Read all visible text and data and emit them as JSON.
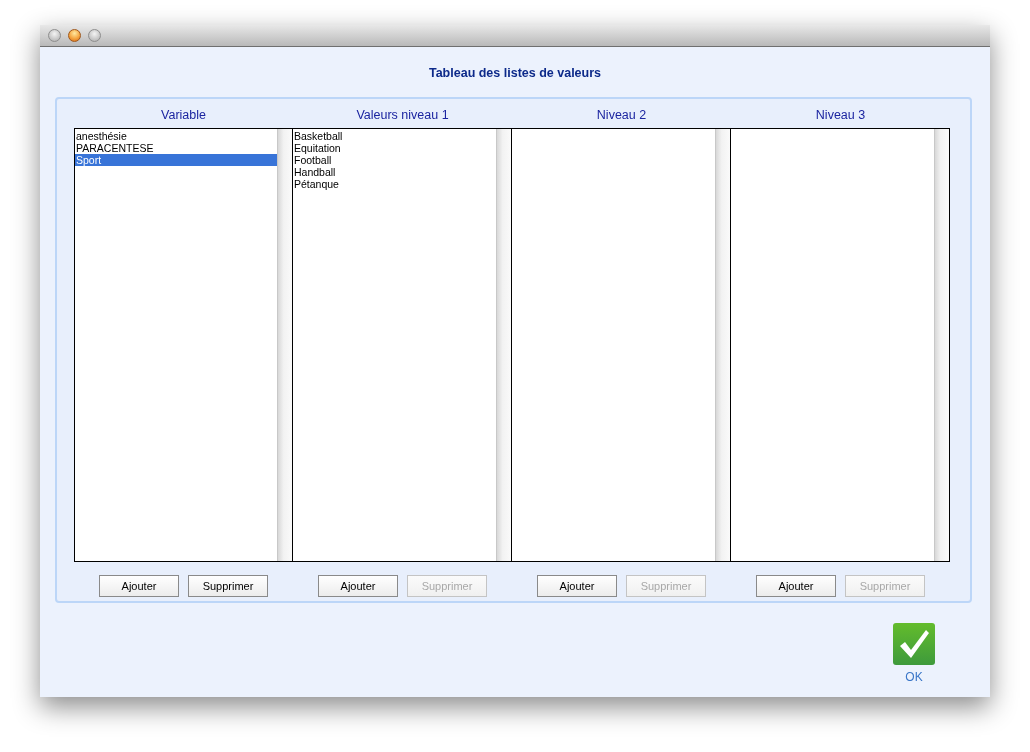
{
  "dialog": {
    "title": "Tableau des listes de valeurs"
  },
  "columns": [
    {
      "header": "Variable",
      "items": [
        {
          "label": "anesthésie",
          "selected": false
        },
        {
          "label": "PARACENTESE",
          "selected": false
        },
        {
          "label": "Sport",
          "selected": true
        }
      ],
      "buttons": [
        {
          "label": "Ajouter",
          "disabled": false
        },
        {
          "label": "Supprimer",
          "disabled": false
        }
      ]
    },
    {
      "header": "Valeurs niveau 1",
      "items": [
        {
          "label": "Basketball",
          "selected": false
        },
        {
          "label": "Equitation",
          "selected": false
        },
        {
          "label": "Football",
          "selected": false
        },
        {
          "label": "Handball",
          "selected": false
        },
        {
          "label": "Pétanque",
          "selected": false
        }
      ],
      "buttons": [
        {
          "label": "Ajouter",
          "disabled": false
        },
        {
          "label": "Supprimer",
          "disabled": true
        }
      ]
    },
    {
      "header": "Niveau 2",
      "buttons": [
        {
          "label": "Ajouter",
          "disabled": false
        },
        {
          "label": "Supprimer",
          "disabled": true
        }
      ]
    },
    {
      "header": "Niveau 3",
      "buttons": [
        {
          "label": "Ajouter",
          "disabled": false
        },
        {
          "label": "Supprimer",
          "disabled": true
        }
      ]
    }
  ],
  "ok_button": {
    "label": "OK"
  }
}
